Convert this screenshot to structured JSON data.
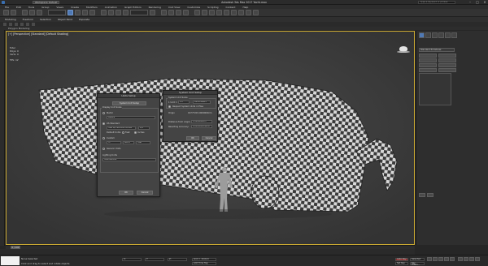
{
  "window": {
    "title": "Autodesk 3ds Max 2017    Yacht.max",
    "workspace": "Workspace: Default",
    "search_placeholder": "Type a keyword or phrase"
  },
  "menu": [
    "File",
    "Edit",
    "Tools",
    "Group",
    "Views",
    "Create",
    "Modifiers",
    "Animation",
    "Graph Editors",
    "Rendering",
    "Civil View",
    "Customize",
    "Scripting",
    "Content",
    "Help"
  ],
  "ribbon": {
    "tabs": [
      "Modeling",
      "Freeform",
      "Selection",
      "Object Paint",
      "Populate"
    ],
    "sub": "Polygon Modeling"
  },
  "viewport": {
    "label": "[+] [Perspective] [Standard] [Default Shading]",
    "stats": [
      {
        "label": "Total",
        "value": ""
      },
      {
        "label": "Polys:",
        "value": "0"
      },
      {
        "label": "Verts:",
        "value": "0"
      },
      {
        "label": "FPS:",
        "value": "Inf"
      }
    ]
  },
  "units_dialog": {
    "title": "Units Setup",
    "system_unit_button": "System Unit Setup",
    "display_group": "Display Unit Scale",
    "metric_label": "Metric",
    "metric_value": "Meters",
    "us_label": "US Standard",
    "us_value": "Feet w/Fractional Inches",
    "us_frac": "1/8",
    "default_units": "Default Units:",
    "feet": "Feet",
    "inches": "Inches",
    "custom_label": "Custom",
    "custom_fields": [
      "FL",
      "660.0",
      "Feet"
    ],
    "generic_label": "Generic Units",
    "lighting_label": "Lighting Units",
    "lighting_value": "International",
    "ok": "OK",
    "cancel": "Cancel"
  },
  "system_dialog": {
    "title": "System Unit Setup",
    "group": "System Unit Scale",
    "scale_prefix": "1 Unit =",
    "scale_value": "1.0",
    "scale_unit": "Centimeters",
    "respect_label": "Respect System Units in Files",
    "origin_label": "Origin",
    "origin_value": "16777215.0000000cm",
    "distance_label": "Distance from origin:",
    "distance_value": "1.0000000cm",
    "accuracy_label": "Resulting Accuracy:",
    "accuracy_value": "0.0000000596cm",
    "ok": "OK",
    "cancel": "Cancel"
  },
  "command_panel": {
    "dropdown": "Standard Primitives",
    "name_field": "Object Type",
    "buttons": [
      "AutoGrid",
      "Box",
      "Cone",
      "Sphere",
      "GeoSphere",
      "Cylinder",
      "Tube",
      "Torus",
      "Pyramid",
      "Teapot",
      "Plane",
      "TextPlus"
    ]
  },
  "timeline": {
    "frame": "0 / 100"
  },
  "status": {
    "line1": "None Selected",
    "line2": "Click and drag to select and rotate objects",
    "x_label": "X:",
    "y_label": "Y:",
    "z_label": "Z:",
    "grid": "Grid = 10.0cm",
    "add_time_tag": "Add Time Tag",
    "auto_key": "Auto Key",
    "selected": "Selected",
    "set_key": "Set Key",
    "key_filters": "Key Filters..."
  },
  "colors": {
    "accent": "#4f79b5",
    "viewport_border": "#c9a832",
    "bg": "#262626"
  }
}
